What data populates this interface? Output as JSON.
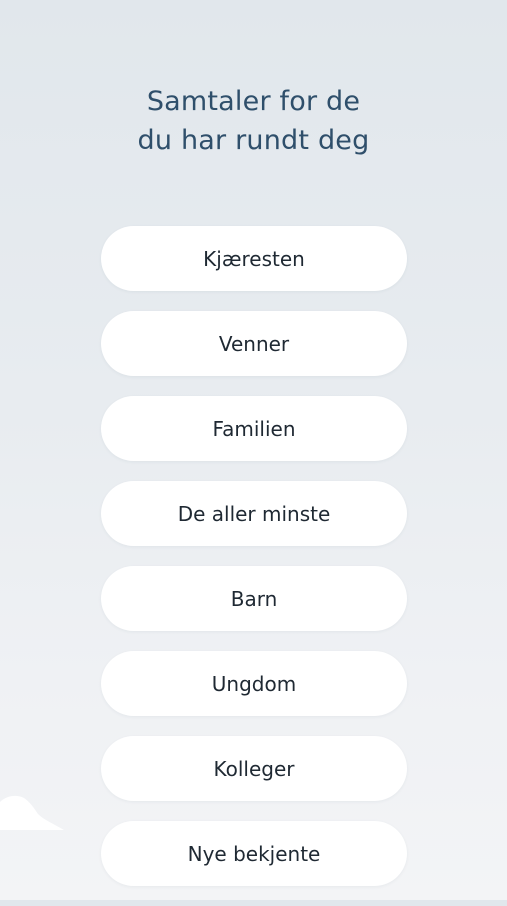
{
  "header": {
    "title_line1": "Samtaler for de",
    "title_line2": "du har rundt deg"
  },
  "menu": {
    "items": [
      {
        "label": "Kjæresten"
      },
      {
        "label": "Venner"
      },
      {
        "label": "Familien"
      },
      {
        "label": "De aller minste"
      },
      {
        "label": "Barn"
      },
      {
        "label": "Ungdom"
      },
      {
        "label": "Kolleger"
      },
      {
        "label": "Nye bekjente"
      }
    ]
  },
  "colors": {
    "title": "#2f4f6b",
    "button_bg": "#ffffff",
    "button_text": "#1f2933",
    "background_top": "#e1e7ec",
    "background_bottom": "#f3f4f6"
  },
  "icons": {
    "decoration": "cloud-icon"
  }
}
